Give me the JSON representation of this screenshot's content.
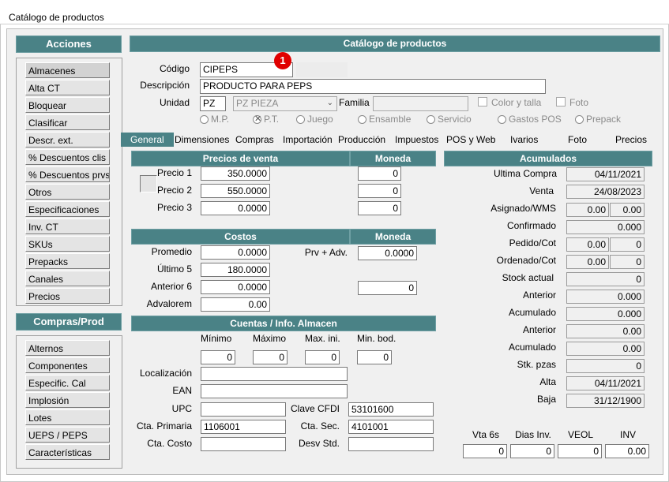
{
  "window": {
    "title": "Catálogo de productos"
  },
  "acciones": {
    "header": "Acciones",
    "items": [
      "Almacenes",
      "Alta CT",
      "Bloquear",
      "Clasificar",
      "Descr. ext.",
      "% Descuentos clis",
      "% Descuentos prvs",
      "Otros",
      "Especificaciones",
      "Inv. CT",
      "SKUs",
      "Prepacks",
      "Canales",
      "Precios"
    ]
  },
  "compras": {
    "header": "Compras/Prod",
    "items": [
      "Alternos",
      "Componentes",
      "Especific. Cal",
      "Implosión",
      "Lotes",
      "UEPS / PEPS",
      "Características"
    ]
  },
  "main": {
    "header": "Catálogo de productos",
    "codigo_label": "Código",
    "codigo_value": "CIPEPS",
    "badge": "1",
    "descripcion_label": "Descripción",
    "descripcion_value": "PRODUCTO PARA PEPS",
    "unidad_label": "Unidad",
    "unidad_value": "PZ",
    "unidad_select": "PZ  PIEZA",
    "familia_label": "Familia",
    "color_talla": "Color y talla",
    "foto": "Foto",
    "radios": [
      "M.P.",
      "P.T.",
      "Juego",
      "Ensamble",
      "Servicio",
      "Gastos POS",
      "Prepack"
    ]
  },
  "tabs": [
    "General",
    "Dimensiones",
    "Compras",
    "Importación",
    "Producción",
    "Impuestos",
    "POS y Web",
    "Ivarios",
    "Foto",
    "Precios"
  ],
  "precios": {
    "header": "Precios de venta",
    "moneda": "Moneda",
    "rows": [
      {
        "label": "Precio 1",
        "value": "350.0000",
        "moneda": "0"
      },
      {
        "label": "Precio 2",
        "value": "550.0000",
        "moneda": "0"
      },
      {
        "label": "Precio 3",
        "value": "0.0000",
        "moneda": "0"
      }
    ]
  },
  "costos": {
    "header": "Costos",
    "moneda": "Moneda",
    "rows": [
      {
        "label": "Promedio",
        "value": "0.0000"
      },
      {
        "label": "Último 5",
        "value": "180.0000"
      },
      {
        "label": "Anterior 6",
        "value": "0.0000"
      },
      {
        "label": "Advalorem",
        "value": "0.00"
      }
    ],
    "prv_label": "Prv + Adv.",
    "prv_value": "0.0000",
    "moneda_value": "0"
  },
  "cuentas": {
    "header": "Cuentas / Info. Almacen",
    "cols": [
      "Mínimo",
      "Máximo",
      "Max. ini.",
      "Min. bod."
    ],
    "vals": [
      "0",
      "0",
      "0",
      "0"
    ],
    "localizacion": "Localización",
    "ean": "EAN",
    "upc": "UPC",
    "clave_cfdi_label": "Clave CFDI",
    "clave_cfdi": "53101600",
    "cta_primaria_label": "Cta. Primaria",
    "cta_primaria": "1106001",
    "cta_sec_label": "Cta. Sec.",
    "cta_sec": "4101001",
    "cta_costo_label": "Cta. Costo",
    "desv_label": "Desv Std."
  },
  "acumulados": {
    "header": "Acumulados",
    "ultima_compra_label": "Ultima  Compra",
    "ultima_compra": "04/11/2021",
    "venta_label": "Venta",
    "venta": "24/08/2023",
    "asignado_label": "Asignado/WMS",
    "asignado_a": "0.00",
    "asignado_b": "0.00",
    "confirmado_label": "Confirmado",
    "confirmado": "0.000",
    "pedido_label": "Pedido/Cot",
    "pedido_a": "0.00",
    "pedido_b": "0",
    "ordenado_label": "Ordenado/Cot",
    "ordenado_a": "0.00",
    "ordenado_b": "0",
    "stock_label": "Stock actual",
    "stock": "0",
    "anterior1_label": "Anterior",
    "anterior1": "0.000",
    "acumulado1_label": "Acumulado",
    "acumulado1": "0.000",
    "anterior2_label": "Anterior",
    "anterior2": "0.00",
    "acumulado2_label": "Acumulado",
    "acumulado2": "0.00",
    "stk_label": "Stk. pzas",
    "stk": "0",
    "alta_label": "Alta",
    "alta": "04/11/2021",
    "baja_label": "Baja",
    "baja": "31/12/1900",
    "bottom_labels": [
      "Vta 6s",
      "Dias Inv.",
      "VEOL",
      "INV"
    ],
    "bottom_values": [
      "0",
      "0",
      "0",
      "0.00"
    ]
  }
}
